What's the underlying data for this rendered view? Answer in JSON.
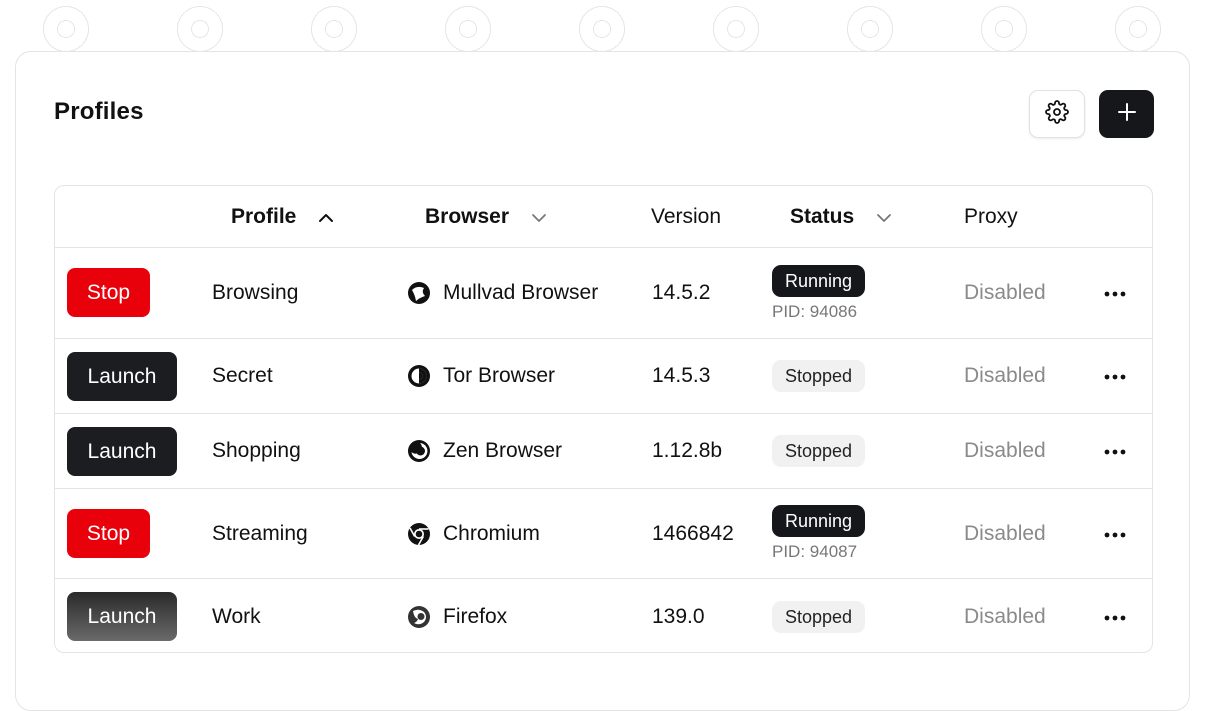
{
  "header": {
    "title": "Profiles",
    "settings_icon": "gear-icon",
    "add_icon": "plus-icon"
  },
  "table": {
    "columns": [
      {
        "label": "Profile",
        "sort": "chevron-up-icon"
      },
      {
        "label": "Browser",
        "sort": "chevron-down-icon"
      },
      {
        "label": "Version"
      },
      {
        "label": "Status",
        "sort": "chevron-down-icon"
      },
      {
        "label": "Proxy"
      }
    ],
    "rows": [
      {
        "action": "Stop",
        "profile": "Browsing",
        "browser": "Mullvad Browser",
        "browser_icon": "mullvad-icon",
        "version": "14.5.2",
        "status": "Running",
        "pid": "PID: 94086",
        "proxy": "Disabled"
      },
      {
        "action": "Launch",
        "profile": "Secret",
        "browser": "Tor Browser",
        "browser_icon": "tor-icon",
        "version": "14.5.3",
        "status": "Stopped",
        "pid": "",
        "proxy": "Disabled"
      },
      {
        "action": "Launch",
        "profile": "Shopping",
        "browser": "Zen Browser",
        "browser_icon": "zen-icon",
        "version": "1.12.8b",
        "status": "Stopped",
        "pid": "",
        "proxy": "Disabled"
      },
      {
        "action": "Stop",
        "profile": "Streaming",
        "browser": "Chromium",
        "browser_icon": "chromium-icon",
        "version": "1466842",
        "status": "Running",
        "pid": "PID: 94087",
        "proxy": "Disabled"
      },
      {
        "action": "Launch",
        "profile": "Work",
        "browser": "Firefox",
        "browser_icon": "firefox-icon",
        "version": "139.0",
        "status": "Stopped",
        "pid": "",
        "proxy": "Disabled"
      }
    ]
  },
  "colors": {
    "stop": "#e8000b",
    "launch": "#1c1d20",
    "running_badge": "#16171a",
    "stopped_badge": "#f1f1f1"
  }
}
